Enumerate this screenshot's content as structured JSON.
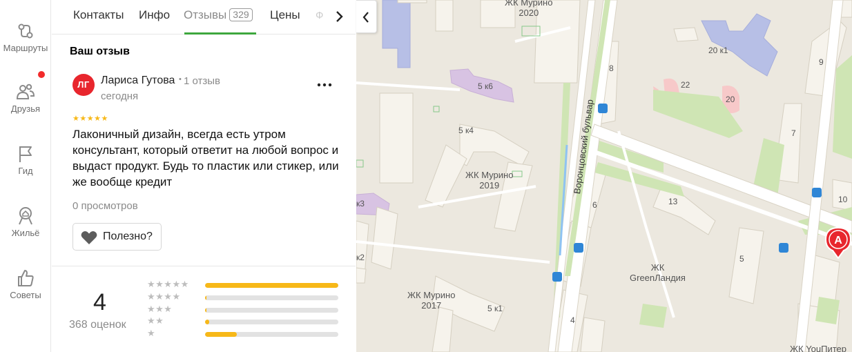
{
  "rail": {
    "items": [
      {
        "label": "Маршруты",
        "icon": "route-icon"
      },
      {
        "label": "Друзья",
        "icon": "friends-icon"
      },
      {
        "label": "Гид",
        "icon": "flag-icon"
      },
      {
        "label": "Жильё",
        "icon": "home-search-icon"
      },
      {
        "label": "Советы",
        "icon": "thumbs-up-icon"
      }
    ]
  },
  "tabs": [
    {
      "label": "Контакты"
    },
    {
      "label": "Инфо"
    },
    {
      "label": "Отзывы",
      "badge": "329"
    },
    {
      "label": "Цены"
    }
  ],
  "tabs_overflow": "Ф",
  "review": {
    "section_title": "Ваш отзыв",
    "avatar_initials": "ЛГ",
    "author": "Лариса Гутова",
    "separator": "•",
    "author_review_count": "1 отзыв",
    "date": "сегодня",
    "rating": 5,
    "text": "Лаконичный дизайн, всегда есть утром консультант, который ответит на любой вопрос и выдаст продукт. Будь то пластик или стикер, или же вообще кредит",
    "views": "0 просмотров",
    "helpful_label": "Полезно?"
  },
  "rating_summary": {
    "value": "4",
    "count_label": "368 оценок",
    "distribution": [
      {
        "stars": "★★★★★",
        "fraction": 1.0
      },
      {
        "stars": "★★★★",
        "fraction": 0.01
      },
      {
        "stars": "★★★",
        "fraction": 0.01
      },
      {
        "stars": "★★",
        "fraction": 0.03
      },
      {
        "stars": "★",
        "fraction": 0.24
      }
    ]
  },
  "map": {
    "labels": {
      "murino2020": "ЖК Мурино\n2020",
      "murino2019": "ЖК Мурино\n2019",
      "murino2017": "ЖК Мурино\n2017",
      "greenland": "ЖК\nGreenЛандия",
      "youpiter": "ЖК YouПитер",
      "street": "Воронцовский бульвар"
    },
    "house_numbers": [
      "5 к6",
      "5 к4",
      "5 к1",
      "20 к1",
      "22",
      "20",
      "8",
      "9",
      "7",
      "6",
      "13",
      "10",
      "5",
      "4",
      "к2",
      "к3"
    ],
    "marker_letter": "А"
  },
  "colors": {
    "accent_green": "#3da73d",
    "star_yellow": "#f7b818",
    "avatar_red": "#e8262d",
    "marker_red": "#e8262d",
    "notification_red": "#f22b2b"
  }
}
